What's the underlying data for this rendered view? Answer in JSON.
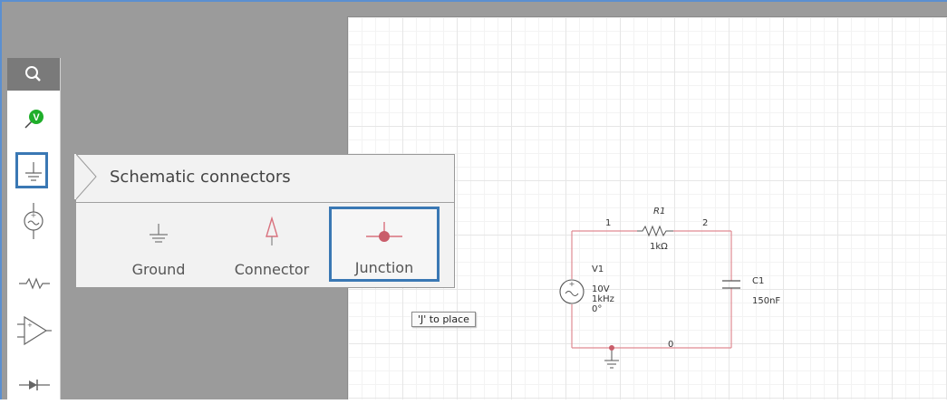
{
  "toolbar": {
    "tools": [
      {
        "id": "search",
        "icon": "search-icon"
      },
      {
        "id": "probe",
        "icon": "voltage-probe-icon",
        "badge": "V"
      },
      {
        "id": "connectors",
        "icon": "ground-icon",
        "selected": true
      },
      {
        "id": "sources",
        "icon": "ac-source-icon"
      },
      {
        "id": "passives",
        "icon": "resistor-icon"
      },
      {
        "id": "analog",
        "icon": "opamp-icon"
      },
      {
        "id": "diodes",
        "icon": "diode-icon"
      }
    ]
  },
  "flyout": {
    "title": "Schematic connectors",
    "parts": [
      {
        "label": "Ground",
        "icon": "ground-icon"
      },
      {
        "label": "Connector",
        "icon": "connector-icon"
      },
      {
        "label": "Junction",
        "icon": "junction-icon",
        "selected": true
      }
    ]
  },
  "tooltip": "'J' to place",
  "circuit": {
    "nodes": {
      "n1": "1",
      "n2": "2",
      "n0": "0"
    },
    "resistor": {
      "name": "R1",
      "value": "1kΩ"
    },
    "capacitor": {
      "name": "C1",
      "value": "150nF"
    },
    "source": {
      "name": "V1",
      "amplitude": "10V",
      "frequency": "1kHz",
      "phase": "0°"
    }
  },
  "colors": {
    "wire": "#e08a92",
    "accent": "#3a78b4",
    "probe_green": "#1fae2a",
    "frame_blue": "#5b8fd0"
  }
}
